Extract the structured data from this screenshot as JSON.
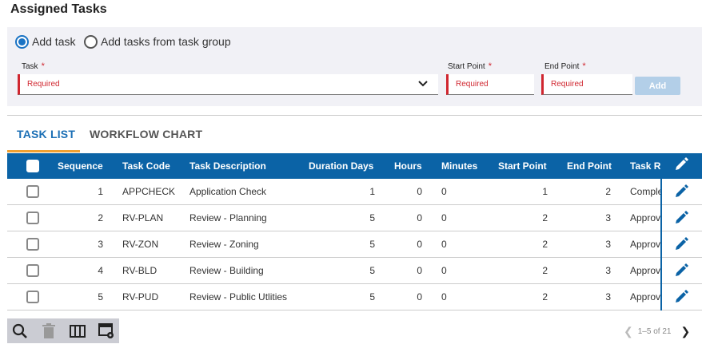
{
  "title": "Assigned Tasks",
  "form": {
    "radio_add_task": "Add task",
    "radio_add_group": "Add tasks from task group",
    "task_label": "Task",
    "start_label": "Start Point",
    "end_label": "End Point",
    "required_star": "*",
    "task_placeholder": "Required",
    "start_placeholder": "Required",
    "end_placeholder": "Required",
    "add_button": "Add"
  },
  "tabs": [
    {
      "label": "TASK LIST"
    },
    {
      "label": "WORKFLOW CHART"
    }
  ],
  "table": {
    "headers": [
      "Sequence",
      "Task Code",
      "Task Description",
      "Duration Days",
      "Hours",
      "Minutes",
      "Start Point",
      "End Point",
      "Task R"
    ],
    "rows": [
      [
        "1",
        "APPCHECK",
        "Application Check",
        "1",
        "0",
        "0",
        "1",
        "2",
        "Comple"
      ],
      [
        "2",
        "RV-PLAN",
        "Review - Planning",
        "5",
        "0",
        "0",
        "2",
        "3",
        "Approv"
      ],
      [
        "3",
        "RV-ZON",
        "Review - Zoning",
        "5",
        "0",
        "0",
        "2",
        "3",
        "Approv"
      ],
      [
        "4",
        "RV-BLD",
        "Review - Building",
        "5",
        "0",
        "0",
        "2",
        "3",
        "Approv"
      ],
      [
        "5",
        "RV-PUD",
        "Review - Public Utlities",
        "5",
        "0",
        "0",
        "2",
        "3",
        "Approv"
      ]
    ]
  },
  "pager": {
    "text": "1–5 of 21"
  },
  "colors": {
    "accent": "#0b63a6",
    "tab_underline": "#f0a030",
    "required": "#d0262f"
  }
}
